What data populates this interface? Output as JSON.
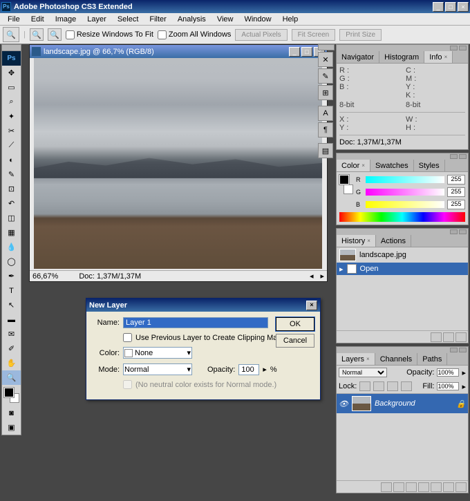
{
  "app": {
    "title": "Adobe Photoshop CS3 Extended"
  },
  "menu": [
    "File",
    "Edit",
    "Image",
    "Layer",
    "Select",
    "Filter",
    "Analysis",
    "View",
    "Window",
    "Help"
  ],
  "options": {
    "resize_windows": "Resize Windows To Fit",
    "zoom_all": "Zoom All Windows",
    "actual": "Actual Pixels",
    "fit": "Fit Screen",
    "print": "Print Size"
  },
  "document": {
    "title": "landscape.jpg @ 66,7% (RGB/8)",
    "zoom": "66,67%",
    "docsize": "Doc: 1,37M/1,37M"
  },
  "dialog": {
    "title": "New Layer",
    "name_label": "Name:",
    "name_value": "Layer 1",
    "clip_label": "Use Previous Layer to Create Clipping Mask",
    "color_label": "Color:",
    "color_value": "None",
    "mode_label": "Mode:",
    "mode_value": "Normal",
    "opacity_label": "Opacity:",
    "opacity_value": "100",
    "opacity_pct": "%",
    "neutral": "(No neutral color exists for Normal mode.)",
    "ok": "OK",
    "cancel": "Cancel"
  },
  "palettes": {
    "info_tabs": [
      "Navigator",
      "Histogram",
      "Info"
    ],
    "info": {
      "r": "R :",
      "g": "G :",
      "b": "B :",
      "c": "C :",
      "m": "M :",
      "y": "Y :",
      "k": "K :",
      "bit": "8-bit",
      "x": "X :",
      "yv": "Y :",
      "w": "W :",
      "h": "H :",
      "doc": "Doc: 1,37M/1,37M"
    },
    "color_tabs": [
      "Color",
      "Swatches",
      "Styles"
    ],
    "color_labels": {
      "r": "R",
      "g": "G",
      "b": "B",
      "val": "255"
    },
    "history_tabs": [
      "History",
      "Actions"
    ],
    "history_file": "landscape.jpg",
    "history_open": "Open",
    "layers_tabs": [
      "Layers",
      "Channels",
      "Paths"
    ],
    "layers": {
      "mode": "Normal",
      "opacity_lbl": "Opacity:",
      "opacity": "100%",
      "lock_lbl": "Lock:",
      "fill_lbl": "Fill:",
      "fill": "100%",
      "bg": "Background"
    }
  }
}
